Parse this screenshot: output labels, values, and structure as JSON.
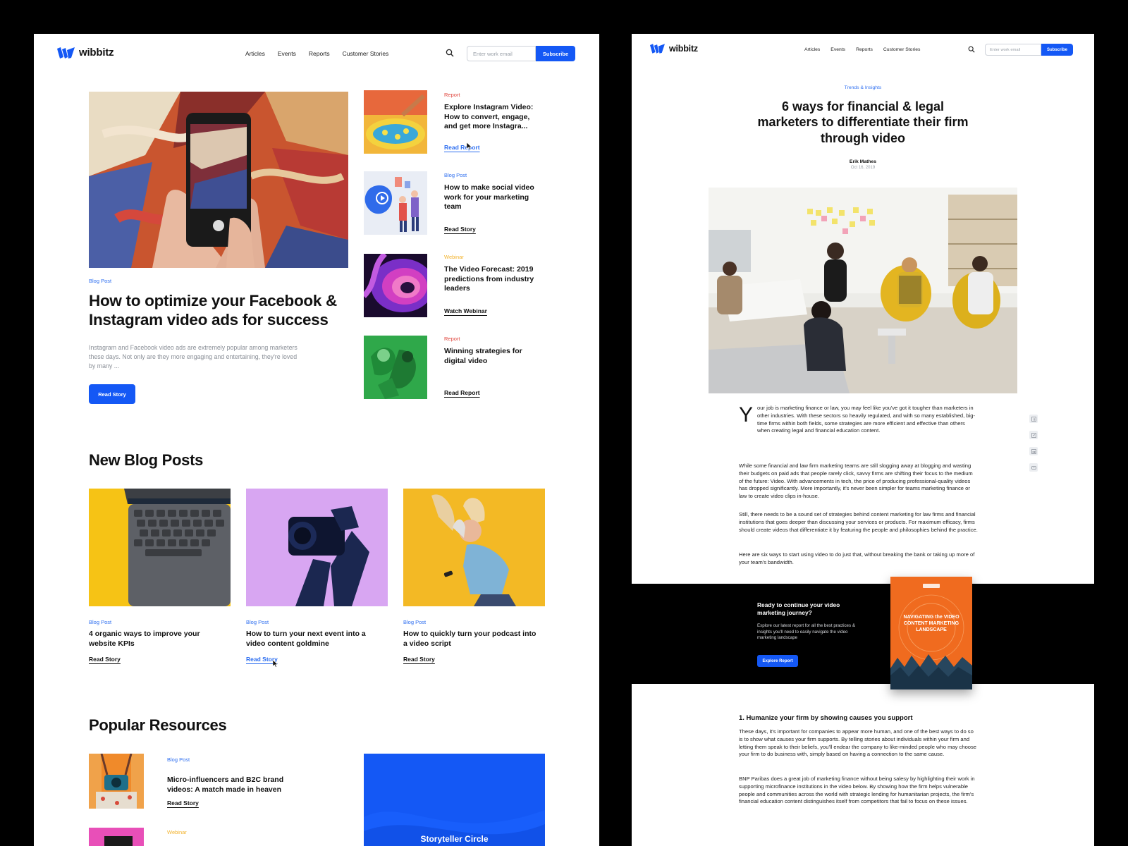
{
  "brand": {
    "name": "wibbitz",
    "accent": "#1458f5"
  },
  "nav": {
    "links": [
      "Articles",
      "Events",
      "Reports",
      "Customer Stories"
    ],
    "email_placeholder": "Enter work email",
    "subscribe_label": "Subscribe"
  },
  "home": {
    "featured": {
      "tag": "Blog Post",
      "title": "How to optimize your Facebook & Instagram video ads for success",
      "description": "Instagram and Facebook video ads are extremely popular among marketers these days. Not only are they more engaging and entertaining, they're loved by many ...",
      "cta": "Read Story"
    },
    "side_items": [
      {
        "tag": "Report",
        "tag_color": "#e0453c",
        "title": "Explore Instagram Video: How to convert, engage, and get more Instagra...",
        "link": "Read Report"
      },
      {
        "tag": "Blog Post",
        "tag_color": "#2d6ef0",
        "title": "How to make social video work for your marketing team",
        "link": "Read Story"
      },
      {
        "tag": "Webinar",
        "tag_color": "#f3b32d",
        "title": "The Video Forecast: 2019 predictions from industry leaders",
        "link": "Watch Webinar"
      },
      {
        "tag": "Report",
        "tag_color": "#e0453c",
        "title": "Winning strategies for digital video",
        "link": "Read Report"
      }
    ],
    "new_blog_posts": {
      "heading": "New Blog Posts",
      "cards": [
        {
          "tag": "Blog Post",
          "title": "4 organic ways to improve your website KPIs",
          "link": "Read Story"
        },
        {
          "tag": "Blog Post",
          "title": "How to turn your next event into a video content goldmine",
          "link": "Read Story"
        },
        {
          "tag": "Blog Post",
          "title": "How to quickly turn your podcast into a video script",
          "link": "Read Story"
        }
      ]
    },
    "popular_resources": {
      "heading": "Popular Resources",
      "items": [
        {
          "tag": "Blog Post",
          "title": "Micro-influencers and B2C brand videos: A match made in heaven",
          "link": "Read Story"
        },
        {
          "tag": "Webinar"
        }
      ],
      "promo_title": "Storyteller Circle"
    }
  },
  "article": {
    "category": "Trends & Insights",
    "title": "6 ways for financial & legal marketers to differentiate their firm through video",
    "author": "Erik Mathes",
    "date": "Oct 16, 2019",
    "dropcap": "Y",
    "intro_first": "our job is marketing finance or law, you may feel like you've got it tougher than marketers in other industries. With these sectors so heavily regulated, and with so many established, big-time firms within both fields, some strategies are more efficient and effective than others when creating legal and financial education content.",
    "paragraphs": [
      "While some financial and law firm marketing teams are still slogging away at blogging and wasting their budgets on paid ads that people rarely click, savvy firms are shifting their focus to the medium of the future: Video. With advancements in tech, the price of producing professional-quality videos has dropped significantly. More importantly, it's never been simpler for teams marketing finance or law to create video clips in-house.",
      "Still, there needs to be a sound set of strategies behind content marketing for law firms and financial institutions that goes deeper than discussing your services or products. For maximum efficacy, firms should create videos that differentiate it by featuring the people and philosophies behind the practice.",
      "Here are six ways to start using video to do just that, without breaking the bank or taking up more of your team's bandwidth."
    ],
    "cta": {
      "title": "Ready to continue your video marketing journey?",
      "description": "Explore our latest report for all the best practices & insights you'll need to easily navigate the video marketing landscape",
      "button": "Explore Report",
      "book_title": "NAVIGATING the VIDEO CONTENT MARKETING LANDSCAPE"
    },
    "section_heading": "1. Humanize your firm by showing causes you support",
    "section_paragraphs": [
      "These days, it's important for companies to appear more human, and one of the best ways to do so is to show what causes your firm supports. By telling stories about individuals within your firm and letting them speak to their beliefs, you'll endear the company to like-minded people who may choose your firm to do business with, simply based on having a connection to the same cause.",
      "BNP Paribas does a great job of marketing finance without being salesy by highlighting their work in supporting microfinance institutions in the video below. By showing how the firm helps vulnerable people and communities across the world with strategic lending for humanitarian projects, the firm's financial education content distinguishes itself from competitors that fail to focus on these issues."
    ],
    "share_icons": [
      "facebook-icon",
      "twitter-icon",
      "linkedin-icon",
      "youtube-icon"
    ]
  }
}
